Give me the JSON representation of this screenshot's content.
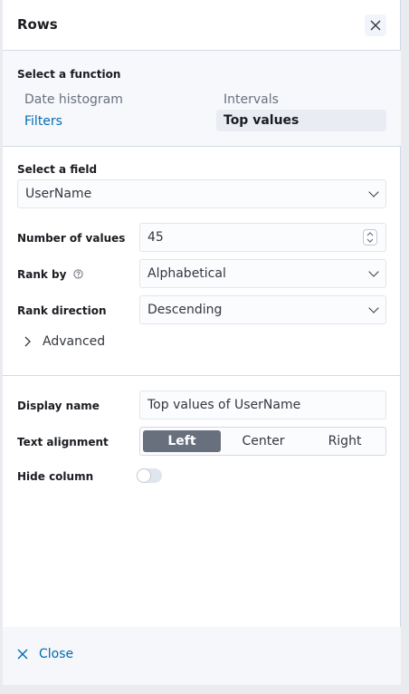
{
  "flyout": {
    "title": "Rows",
    "close_footer_label": "Close"
  },
  "function": {
    "label": "Select a function",
    "options": [
      "Date histogram",
      "Intervals",
      "Filters",
      "Top values"
    ],
    "selected": "Top values"
  },
  "field": {
    "label": "Select a field",
    "value": "UserName"
  },
  "number_of_values": {
    "label": "Number of values",
    "value": "45"
  },
  "rank_by": {
    "label": "Rank by",
    "value": "Alphabetical"
  },
  "rank_direction": {
    "label": "Rank direction",
    "value": "Descending"
  },
  "advanced": {
    "label": "Advanced"
  },
  "display_name": {
    "label": "Display name",
    "value": "Top values of UserName"
  },
  "text_alignment": {
    "label": "Text alignment",
    "options": [
      "Left",
      "Center",
      "Right"
    ],
    "selected": "Left"
  },
  "hide_column": {
    "label": "Hide column",
    "enabled": false
  },
  "colors": {
    "accent": "#006bb4",
    "selected_segment": "#69707d"
  }
}
